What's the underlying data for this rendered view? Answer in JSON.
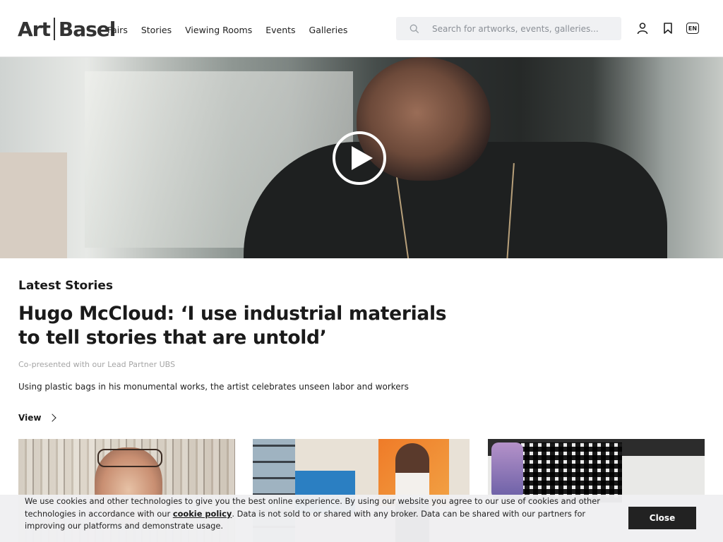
{
  "brand": {
    "logo_left": "Art",
    "logo_right": "Basel"
  },
  "nav": [
    "Fairs",
    "Stories",
    "Viewing Rooms",
    "Events",
    "Galleries"
  ],
  "search": {
    "placeholder": "Search for artworks, events, galleries..."
  },
  "header_icons": [
    "user-icon",
    "bookmark-icon",
    "language-icon"
  ],
  "language": "EN",
  "hero": {
    "play_icon": "play-icon"
  },
  "story": {
    "section_title": "Latest Stories",
    "headline": "Hugo McCloud: ‘I use industrial materials to tell stories that are untold’",
    "partner": "Co-presented with our Lead Partner UBS",
    "description": "Using plastic bags in his monumental works, the artist celebrates unseen labor and workers",
    "view_label": "View"
  },
  "cookie": {
    "text_before": "We use cookies and other technologies to give you the best online experience. By using our website you agree to our use of cookies and other technologies in accordance with our ",
    "link": "cookie policy",
    "text_after": ". Data is not sold to or shared with any broker. Data can be shared with our partners for improving our platforms and demonstrate usage.",
    "close_label": "Close"
  }
}
